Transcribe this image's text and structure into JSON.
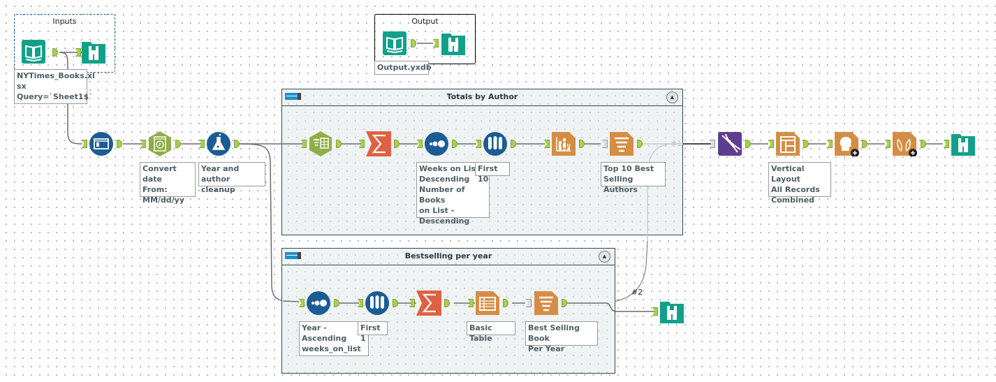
{
  "canvas": {
    "containers": [
      {
        "id": "totals",
        "title": "Totals by Author",
        "collapse_icon": "collapse-up-icon"
      },
      {
        "id": "bestselling",
        "title": "Bestselling per year",
        "collapse_icon": "collapse-up-icon"
      }
    ],
    "frames": [
      {
        "id": "inputs",
        "title": "Inputs"
      },
      {
        "id": "output",
        "title": "Output"
      }
    ],
    "annotations": {
      "input_file": "NYTimes_Books.xl\nsx\nQuery=`Sheet1$`",
      "output_file": "Output.yxdb",
      "convert_date": "Convert date\nFrom:\nMM/dd/yy",
      "year_author_cleanup": "Year and author\ncleanup",
      "sort_weeks": "Weeks on List -\nDescending\nNumber of Books\non List -\nDescending",
      "first_10": "First 10",
      "top10_authors": "Top 10 Best\nSelling Authors",
      "vertical_layout": "Vertical Layout\nAll Records\nCombined",
      "sort_year": "Year - Ascending\nweeks_on_list -\nDescending",
      "first_1": "First 1",
      "basic_table": "Basic Table",
      "best_book_year": "Best Selling Book\nPer Year"
    },
    "wire_labels": {
      "w1": "#1",
      "w2": "#2"
    },
    "tools": [
      {
        "name": "input-data-tool",
        "icon": "book-icon",
        "color": "#12a08a"
      },
      {
        "name": "browse-tool",
        "icon": "binoculars-icon",
        "color": "#12a08a"
      },
      {
        "name": "select-tool",
        "icon": "select-icon",
        "color": "#1b5c94"
      },
      {
        "name": "datetime-tool",
        "icon": "clock-icon",
        "color": "#8fae45"
      },
      {
        "name": "formula-tool",
        "icon": "flask-icon",
        "color": "#1b5c94"
      },
      {
        "name": "filter-tool",
        "icon": "filter-table-icon",
        "color": "#8fae45"
      },
      {
        "name": "summarize-tool",
        "icon": "sigma-icon",
        "color": "#de6141"
      },
      {
        "name": "sort-tool",
        "icon": "sort-dots-icon",
        "color": "#1b5c94"
      },
      {
        "name": "sample-tool",
        "icon": "test-tubes-icon",
        "color": "#1b5c94"
      },
      {
        "name": "interactive-chart-tool",
        "icon": "chart-icon",
        "color": "#d58d45"
      },
      {
        "name": "layout-tool",
        "icon": "layout-icon",
        "color": "#d58d45"
      },
      {
        "name": "union-tool",
        "icon": "dna-icon",
        "color": "#5e3d8f"
      },
      {
        "name": "header-tool",
        "icon": "head-icon",
        "color": "#d58d45"
      },
      {
        "name": "footer-tool",
        "icon": "feet-icon",
        "color": "#d58d45"
      },
      {
        "name": "table-tool",
        "icon": "table-icon",
        "color": "#d58d45"
      }
    ]
  }
}
